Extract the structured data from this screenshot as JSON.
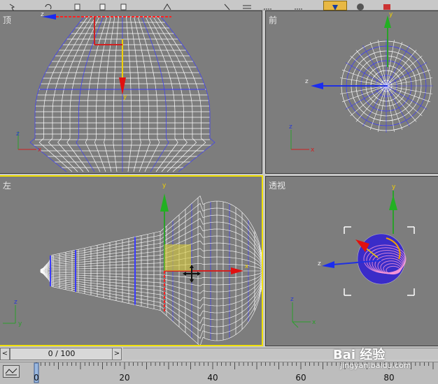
{
  "toolbar": {
    "icons": [
      "select-icon",
      "rotate-icon",
      "copy-icon",
      "paste-icon",
      "undo-icon",
      "snap-icon",
      "align-icon",
      "array-icon",
      "layer-icon",
      "material-icon",
      "render-icon",
      "teapot-icon"
    ],
    "active_color": "#e8b844"
  },
  "viewports": {
    "top": {
      "label": "顶",
      "axes": {
        "vertical": "z",
        "horizontal": "x"
      },
      "gizmo_axes": {
        "a": "z",
        "b": "y"
      }
    },
    "front": {
      "label": "前",
      "axes": {
        "vertical": "z",
        "horizontal": "x"
      },
      "gizmo_axes": {
        "a": "z",
        "b": "y"
      }
    },
    "left": {
      "label": "左",
      "axes": {
        "vertical": "z",
        "horizontal": "y"
      },
      "gizmo_axes": {
        "a": "y",
        "b": "x"
      }
    },
    "perspective": {
      "label": "透视",
      "axes": {
        "vertical": "z",
        "horizontal": "x"
      },
      "gizmo_axes": {
        "a": "y",
        "b": "z"
      }
    }
  },
  "track": {
    "prev": "<",
    "frame_display": "0 / 100",
    "next": ">"
  },
  "timeline": {
    "ticks": [
      "0",
      "20",
      "40",
      "60",
      "80"
    ]
  },
  "watermark": {
    "main": "Bai 经验",
    "sub": "jingyan.baidu.com"
  },
  "colors": {
    "viewport_bg": "#7d7d7d",
    "active_border": "#f0e000",
    "wire_white": "#ffffff",
    "wire_blue": "#3a3aff",
    "wire_red": "#ff2020",
    "axis_green": "#2aa02a",
    "axis_red": "#d02020",
    "axis_blue": "#2030e0"
  }
}
